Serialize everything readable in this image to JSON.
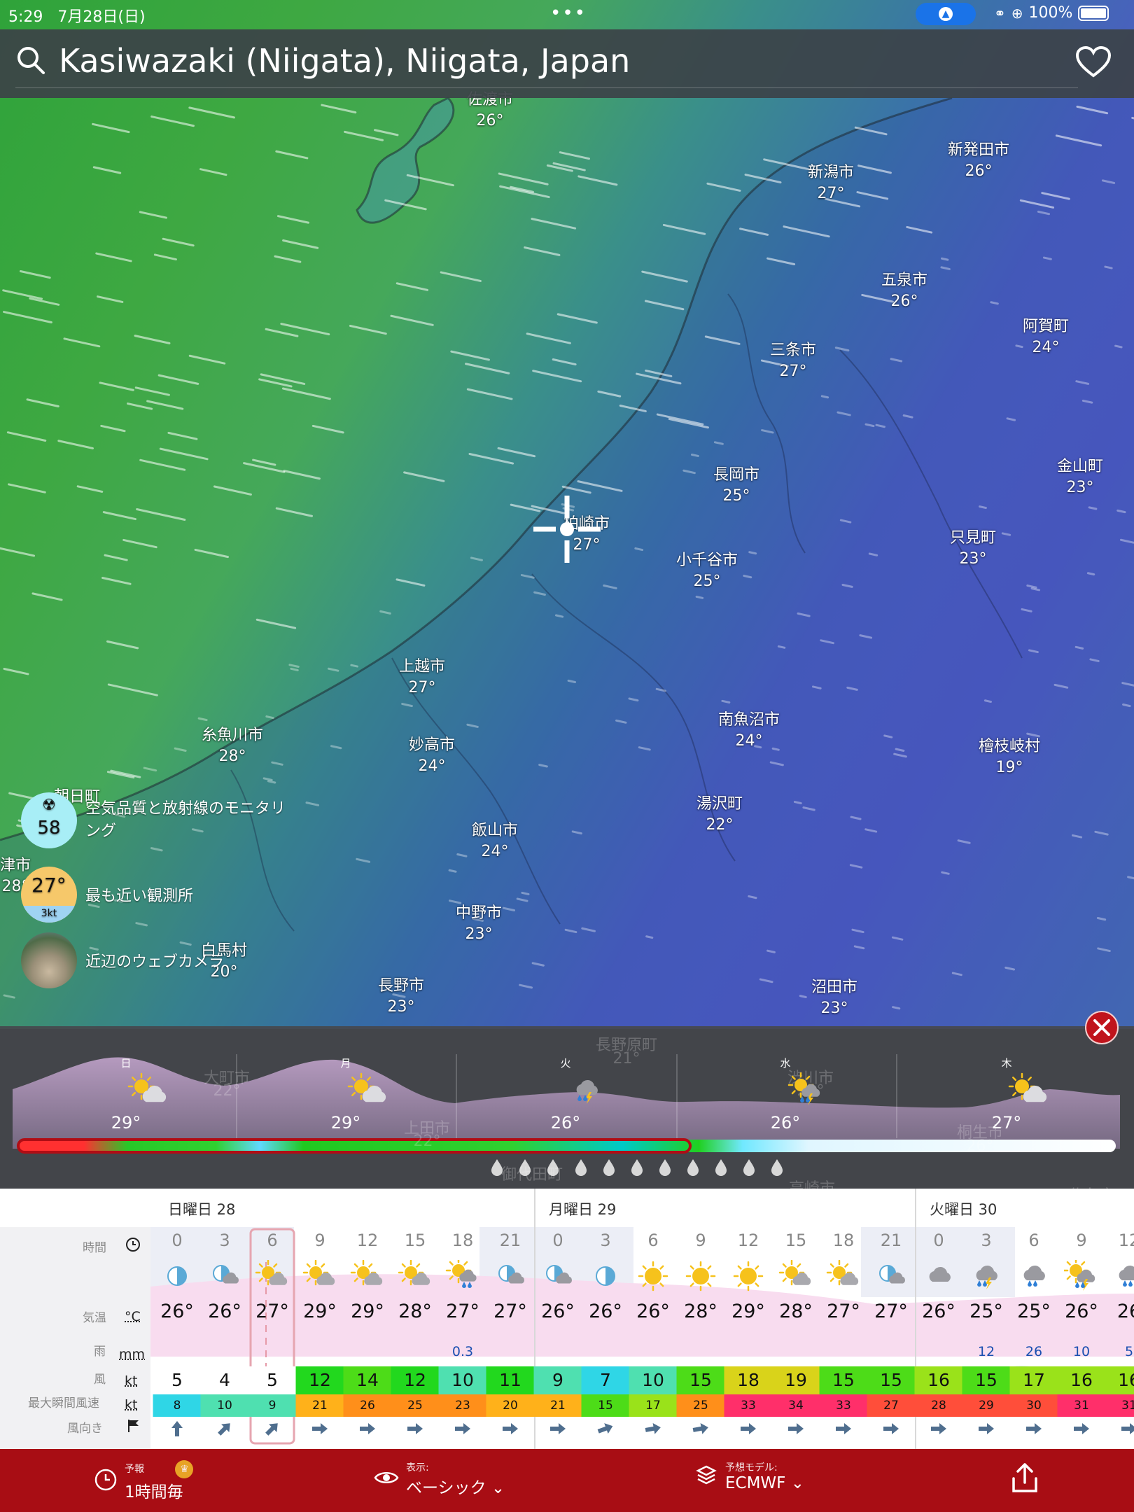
{
  "status": {
    "time": "5:29",
    "date": "7月28日(日)",
    "battery": "100%"
  },
  "search": {
    "location": "Kasiwazaki (Niigata), Niigata, Japan"
  },
  "map_cities": [
    {
      "name": "佐渡市",
      "temp": "26°"
    },
    {
      "name": "新潟市",
      "temp": "27°"
    },
    {
      "name": "新発田市",
      "temp": "26°"
    },
    {
      "name": "五泉市",
      "temp": "26°"
    },
    {
      "name": "三条市",
      "temp": "27°"
    },
    {
      "name": "阿賀町",
      "temp": "24°"
    },
    {
      "name": "金山町",
      "temp": "23°"
    },
    {
      "name": "長岡市",
      "temp": "25°"
    },
    {
      "name": "柏崎市",
      "temp": "27°"
    },
    {
      "name": "只見町",
      "temp": "23°"
    },
    {
      "name": "小千谷市",
      "temp": "25°"
    },
    {
      "name": "上越市",
      "temp": "27°"
    },
    {
      "name": "糸魚川市",
      "temp": "28°"
    },
    {
      "name": "妙高市",
      "temp": "24°"
    },
    {
      "name": "南魚沼市",
      "temp": "24°"
    },
    {
      "name": "檜枝岐村",
      "temp": "19°"
    },
    {
      "name": "湯沢町",
      "temp": "22°"
    },
    {
      "name": "飯山市",
      "temp": "24°"
    },
    {
      "name": "中野市",
      "temp": "23°"
    },
    {
      "name": "白馬村",
      "temp": "20°"
    },
    {
      "name": "長野市",
      "temp": "23°"
    },
    {
      "name": "沼田市",
      "temp": "23°"
    },
    {
      "name": "朝日町",
      "temp": ""
    },
    {
      "name": "津市",
      "temp": "28°"
    }
  ],
  "side_items": {
    "air_quality": {
      "value": "58",
      "label": "空気品質と放射線のモニタリング"
    },
    "station": {
      "temp": "27°",
      "wind": "3kt",
      "label": "最も近い観測所"
    },
    "webcam": {
      "label": "近辺のウェブカメラ"
    }
  },
  "timeline": {
    "days": [
      {
        "day": "日",
        "temp": "29°",
        "icon": "partly-cloudy-icon"
      },
      {
        "day": "月",
        "temp": "29°",
        "icon": "partly-cloudy-icon"
      },
      {
        "day": "火",
        "temp": "26°",
        "icon": "thunderstorm-icon"
      },
      {
        "day": "水",
        "temp": "26°",
        "icon": "sun-rain-thunder-icon"
      },
      {
        "day": "木",
        "temp": "27°",
        "icon": "partly-cloudy-icon"
      }
    ],
    "faded_labels": [
      "長野原町",
      "21°",
      "大町市",
      "22°",
      "渋川市",
      "24°",
      "上田市",
      "22°",
      "桐生市",
      "26°",
      "御代田町",
      "高崎市",
      "佐久市"
    ]
  },
  "table": {
    "days": [
      {
        "label": "日曜日 28"
      },
      {
        "label": "月曜日 29"
      },
      {
        "label": "火曜日 30"
      }
    ],
    "labels": {
      "time": "時間",
      "temp": "気温",
      "temp_unit": "°C",
      "rain": "雨",
      "rain_unit": "mm",
      "wind": "風",
      "wind_unit": "kt",
      "gust": "最大瞬間風速",
      "gust_unit": "kt",
      "dir": "風向き"
    },
    "hours": [
      "0",
      "3",
      "6",
      "9",
      "12",
      "15",
      "18",
      "21",
      "0",
      "3",
      "6",
      "9",
      "12",
      "15",
      "18",
      "21",
      "0",
      "3",
      "6",
      "9",
      "12"
    ],
    "icons": [
      "moon-half",
      "moon-cloud",
      "sun-cloud",
      "sun-cloud",
      "sun-cloud",
      "sun-cloud",
      "sun-rain",
      "moon-cloud",
      "moon-cloud",
      "moon-half",
      "sun",
      "sun",
      "sun",
      "sun-cloud",
      "sun-cloud",
      "moon-cloud",
      "cloud",
      "thunderstorm",
      "rain-cloud",
      "sun-rain-thunder",
      "rain-cloud"
    ],
    "temps": [
      "26°",
      "26°",
      "27°",
      "29°",
      "29°",
      "28°",
      "27°",
      "27°",
      "26°",
      "26°",
      "26°",
      "28°",
      "29°",
      "28°",
      "27°",
      "27°",
      "26°",
      "25°",
      "25°",
      "26°",
      "26"
    ],
    "rain": [
      "",
      "",
      "",
      "",
      "",
      "",
      "0.3",
      "",
      "",
      "",
      "",
      "",
      "",
      "",
      "",
      "",
      "",
      "12",
      "26",
      "10",
      "5"
    ],
    "wind": [
      "5",
      "4",
      "5",
      "12",
      "14",
      "12",
      "10",
      "11",
      "9",
      "7",
      "10",
      "15",
      "18",
      "19",
      "15",
      "15",
      "16",
      "15",
      "17",
      "16",
      "16"
    ],
    "gust": [
      "8",
      "10",
      "9",
      "21",
      "26",
      "25",
      "23",
      "20",
      "21",
      "15",
      "17",
      "25",
      "33",
      "34",
      "33",
      "27",
      "28",
      "29",
      "30",
      "31",
      "31"
    ],
    "dir_deg": [
      0,
      45,
      45,
      90,
      90,
      90,
      90,
      90,
      90,
      70,
      80,
      80,
      90,
      90,
      90,
      90,
      90,
      90,
      90,
      90,
      90
    ]
  },
  "bottom": {
    "forecast_small": "予報",
    "forecast_big": "1時間毎",
    "view_small": "表示:",
    "view_big": "ベーシック",
    "model_small": "予想モデル:",
    "model_big": "ECMWF"
  }
}
